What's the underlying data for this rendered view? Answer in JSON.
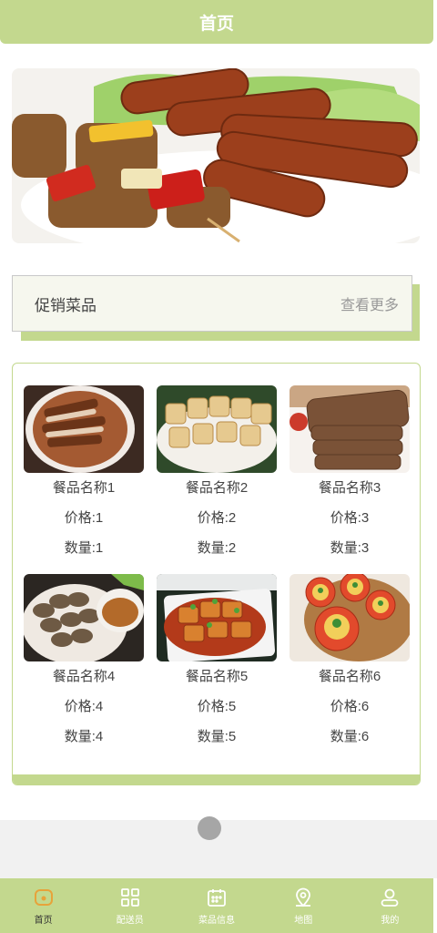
{
  "header": {
    "title": "首页"
  },
  "banner": {
    "image": "grilled-sausages-and-kebabs-photo"
  },
  "promo": {
    "title": "促销菜品",
    "more": "查看更多"
  },
  "items": [
    {
      "name": "餐品名称1",
      "price": "价格:1",
      "qty": "数量:1",
      "image": "braised-pork-photo"
    },
    {
      "name": "餐品名称2",
      "price": "价格:2",
      "qty": "数量:2",
      "image": "tofu-skewers-photo"
    },
    {
      "name": "餐品名称3",
      "price": "价格:3",
      "qty": "数量:3",
      "image": "brown-bread-photo"
    },
    {
      "name": "餐品名称4",
      "price": "价格:4",
      "qty": "数量:4",
      "image": "dumplings-with-sauce-photo"
    },
    {
      "name": "餐品名称5",
      "price": "价格:5",
      "qty": "数量:5",
      "image": "braised-tofu-photo"
    },
    {
      "name": "餐品名称6",
      "price": "价格:6",
      "qty": "数量:6",
      "image": "stuffed-tomatoes-photo"
    }
  ],
  "tabbar": {
    "items": [
      {
        "label": "首页",
        "icon": "home-icon",
        "active": true
      },
      {
        "label": "配送员",
        "icon": "grid-icon",
        "active": false
      },
      {
        "label": "菜品信息",
        "icon": "calendar-icon",
        "active": false
      },
      {
        "label": "地图",
        "icon": "map-pin-icon",
        "active": false
      },
      {
        "label": "我的",
        "icon": "user-icon",
        "active": false
      }
    ]
  },
  "colors": {
    "accent": "#c3d88e",
    "active_icon": "#e7a33a"
  }
}
